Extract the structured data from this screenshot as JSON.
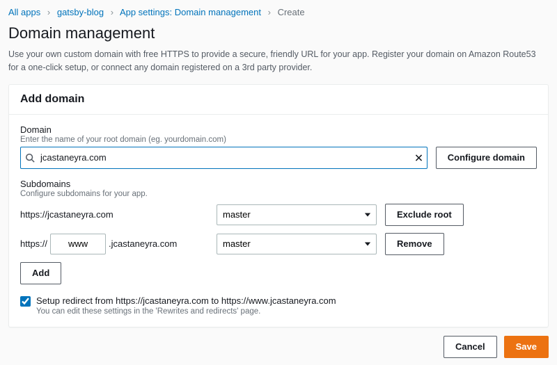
{
  "breadcrumb": {
    "all_apps": "All apps",
    "app": "gatsby-blog",
    "section": "App settings: Domain management",
    "current": "Create"
  },
  "page": {
    "title": "Domain management",
    "description": "Use your own custom domain with free HTTPS to provide a secure, friendly URL for your app. Register your domain on Amazon Route53 for a one-click setup, or connect any domain registered on a 3rd party provider."
  },
  "panel": {
    "title": "Add domain"
  },
  "domain": {
    "label": "Domain",
    "hint": "Enter the name of your root domain (eg. yourdomain.com)",
    "value": "jcastaneyra.com",
    "configure_btn": "Configure domain"
  },
  "subdomains": {
    "label": "Subdomains",
    "hint": "Configure subdomains for your app.",
    "rows": [
      {
        "prefix": "https://jcastaneyra.com",
        "branch": "master",
        "action": "Exclude root"
      },
      {
        "proto": "https://",
        "sub_value": "www",
        "suffix": ".jcastaneyra.com",
        "branch": "master",
        "action": "Remove"
      }
    ],
    "add_btn": "Add"
  },
  "redirect": {
    "checked": true,
    "label": "Setup redirect from https://jcastaneyra.com to https://www.jcastaneyra.com",
    "hint": "You can edit these settings in the 'Rewrites and redirects' page."
  },
  "footer": {
    "cancel": "Cancel",
    "save": "Save"
  }
}
